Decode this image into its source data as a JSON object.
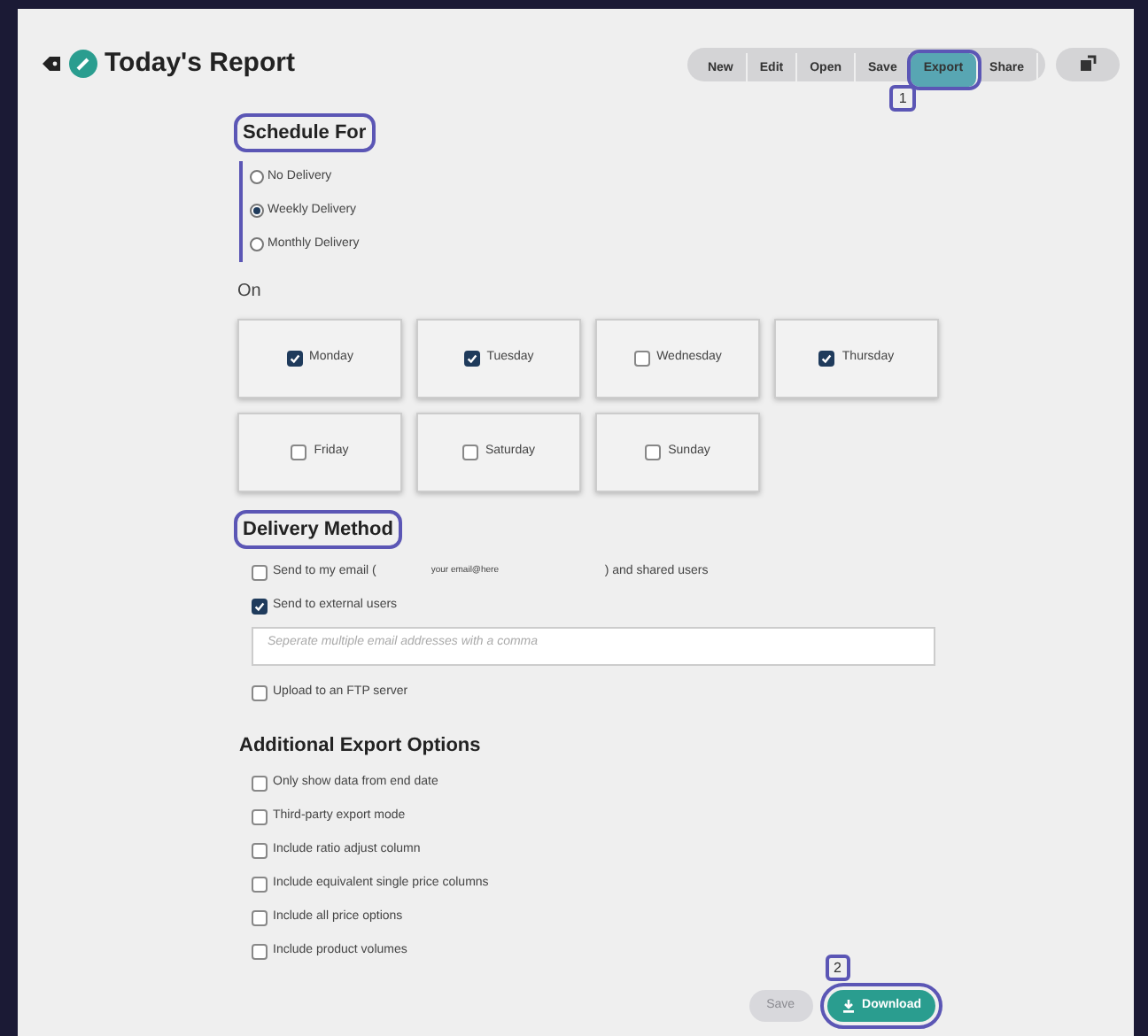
{
  "header": {
    "title": "Today's Report",
    "toolbar": [
      {
        "label": "New",
        "selected": false,
        "highlighted": false
      },
      {
        "label": "Edit",
        "selected": false,
        "highlighted": false
      },
      {
        "label": "Open",
        "selected": false,
        "highlighted": false
      },
      {
        "label": "Save",
        "selected": false,
        "highlighted": false
      },
      {
        "label": "Export",
        "selected": true,
        "highlighted": true,
        "callout": "1"
      },
      {
        "label": "Share",
        "selected": false,
        "highlighted": false
      }
    ]
  },
  "schedule": {
    "title": "Schedule For",
    "highlighted": true,
    "options": [
      {
        "label": "No Delivery",
        "selected": false
      },
      {
        "label": "Weekly Delivery",
        "selected": true
      },
      {
        "label": "Monthly Delivery",
        "selected": false
      }
    ]
  },
  "on": {
    "label": "On",
    "days": [
      {
        "label": "Monday",
        "checked": true
      },
      {
        "label": "Tuesday",
        "checked": true
      },
      {
        "label": "Wednesday",
        "checked": false
      },
      {
        "label": "Thursday",
        "checked": true
      },
      {
        "label": "Friday",
        "checked": false
      },
      {
        "label": "Saturday",
        "checked": false
      },
      {
        "label": "Sunday",
        "checked": false
      }
    ]
  },
  "delivery": {
    "title": "Delivery Method",
    "highlighted": true,
    "email_option": {
      "label": "Send to my email (",
      "value": "your email@here",
      "suffix": ") and shared users",
      "checked": false
    },
    "external_option": {
      "label": "Send to external users",
      "checked": true
    },
    "addresses": {
      "placeholder": "Seperate multiple email addresses with a comma"
    },
    "ftp_option": {
      "label": "Upload to an FTP server",
      "checked": false
    }
  },
  "additional": {
    "title": "Additional Export Options",
    "options": [
      {
        "label": "Only show data from end date",
        "checked": false
      },
      {
        "label": "Third-party export mode",
        "checked": false
      },
      {
        "label": "Include ratio adjust column",
        "checked": false
      },
      {
        "label": "Include equivalent single price columns",
        "checked": false
      },
      {
        "label": "Include all price options",
        "checked": false
      },
      {
        "label": "Include product volumes",
        "checked": false
      }
    ]
  },
  "footer": {
    "save": {
      "label": "Save",
      "disabled": true
    },
    "download": {
      "label": "Download",
      "highlighted": true,
      "callout": "2"
    }
  }
}
